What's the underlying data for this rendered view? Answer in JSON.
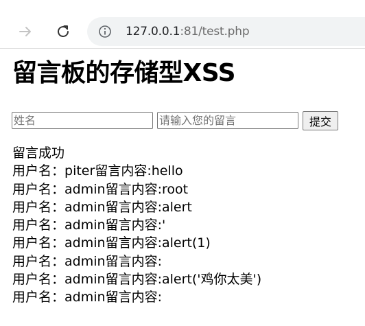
{
  "browser": {
    "url_host": "127.0.0.1",
    "url_rest": ":81/test.php"
  },
  "page": {
    "title": "留言板的存储型XSS",
    "form": {
      "name_placeholder": "姓名",
      "message_placeholder": "请输入您的留言",
      "submit_label": "提交"
    },
    "status_text": "留言成功",
    "messages": [
      {
        "user_prefix": "用户名：",
        "user": "piter",
        "content_prefix": "留言内容:",
        "content": "hello"
      },
      {
        "user_prefix": "用户名：",
        "user": "admin",
        "content_prefix": "留言内容:",
        "content": "root"
      },
      {
        "user_prefix": "用户名：",
        "user": "admin",
        "content_prefix": "留言内容:",
        "content": "alert"
      },
      {
        "user_prefix": "用户名：",
        "user": "admin",
        "content_prefix": "留言内容:",
        "content": "'"
      },
      {
        "user_prefix": "用户名：",
        "user": "admin",
        "content_prefix": "留言内容:",
        "content": "alert(1)"
      },
      {
        "user_prefix": "用户名：",
        "user": "admin",
        "content_prefix": "留言内容:",
        "content": ""
      },
      {
        "user_prefix": "用户名：",
        "user": "admin",
        "content_prefix": "留言内容:",
        "content": "alert('鸡你太美')"
      },
      {
        "user_prefix": "用户名：",
        "user": "admin",
        "content_prefix": "留言内容:",
        "content": ""
      }
    ]
  },
  "icons": {
    "forward": "arrow-right-icon",
    "reload": "reload-icon",
    "info": "info-icon"
  }
}
